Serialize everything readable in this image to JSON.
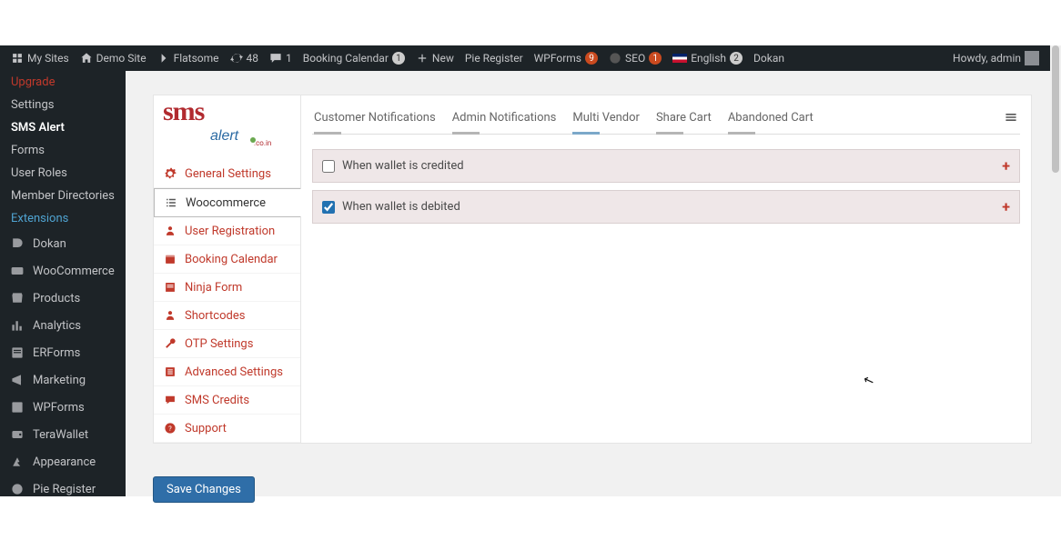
{
  "adminbar": {
    "my_sites": "My Sites",
    "demo_site": "Demo Site",
    "flatsome": "Flatsome",
    "updates": "48",
    "comments": "1",
    "booking": "Booking Calendar",
    "booking_badge": "1",
    "new": "New",
    "pie_register": "Pie Register",
    "wpforms": "WPForms",
    "wpforms_badge": "9",
    "seo": "SEO",
    "seo_badge": "1",
    "english": "English",
    "english_badge": "2",
    "dokan": "Dokan",
    "howdy": "Howdy, admin"
  },
  "wp_sidebar": {
    "upgrade": "Upgrade",
    "settings": "Settings",
    "sms_alert": "SMS Alert",
    "forms": "Forms",
    "user_roles": "User Roles",
    "member_directories": "Member Directories",
    "extensions": "Extensions",
    "items": [
      {
        "label": "Dokan"
      },
      {
        "label": "WooCommerce"
      },
      {
        "label": "Products"
      },
      {
        "label": "Analytics"
      },
      {
        "label": "ERForms"
      },
      {
        "label": "Marketing"
      },
      {
        "label": "WPForms"
      },
      {
        "label": "TeraWallet"
      },
      {
        "label": "Appearance"
      },
      {
        "label": "Pie Register"
      }
    ]
  },
  "plugin_sidebar": {
    "logo_main": "sms",
    "logo_sub": "alert",
    "logo_tld": ".co.in",
    "items": [
      {
        "label": "General Settings",
        "icon": "gear"
      },
      {
        "label": "Woocommerce",
        "icon": "list",
        "active": true
      },
      {
        "label": "User Registration",
        "icon": "user"
      },
      {
        "label": "Booking Calendar",
        "icon": "calendar"
      },
      {
        "label": "Ninja Form",
        "icon": "form"
      },
      {
        "label": "Shortcodes",
        "icon": "user"
      },
      {
        "label": "OTP Settings",
        "icon": "wrench"
      },
      {
        "label": "Advanced Settings",
        "icon": "sliders"
      },
      {
        "label": "SMS Credits",
        "icon": "chat"
      },
      {
        "label": "Support",
        "icon": "question"
      }
    ]
  },
  "tabs": [
    {
      "label": "Customer Notifications",
      "ind": "gray"
    },
    {
      "label": "Admin Notifications",
      "ind": "gray"
    },
    {
      "label": "Multi Vendor",
      "ind": "blue"
    },
    {
      "label": "Share Cart",
      "ind": "gray"
    },
    {
      "label": "Abandoned Cart",
      "ind": "gray"
    }
  ],
  "accordion": [
    {
      "label": "When wallet is credited",
      "checked": false
    },
    {
      "label": "When wallet is debited",
      "checked": true
    }
  ],
  "buttons": {
    "save": "Save Changes",
    "plus": "+"
  }
}
